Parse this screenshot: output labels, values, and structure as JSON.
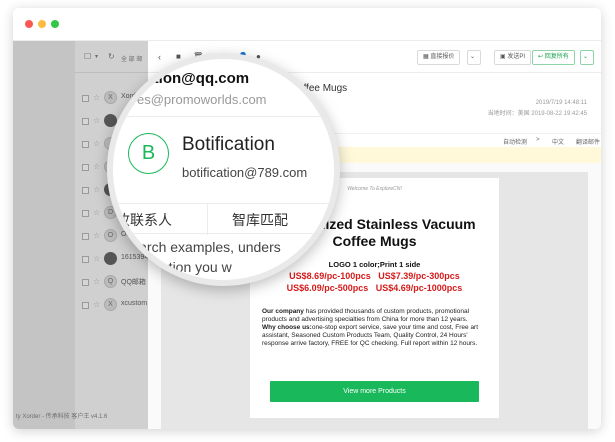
{
  "list_toolbar": {
    "icon_names": [
      "checkbox-icon",
      "refresh-icon"
    ],
    "text": "全 部 邮"
  },
  "mail_list": [
    {
      "avatar_text": "X",
      "from": "Xorder",
      "dark": false
    },
    {
      "avatar_text": "",
      "from": "",
      "dark": true
    },
    {
      "avatar_text": "",
      "from": "",
      "dark": false
    },
    {
      "avatar_text": "",
      "from": "",
      "dark": false
    },
    {
      "avatar_text": "",
      "from": "",
      "dark": true
    },
    {
      "avatar_text": "D",
      "from": "Delia",
      "dark": false
    },
    {
      "avatar_text": "O",
      "from": "OSChina",
      "dark": false
    },
    {
      "avatar_text": "",
      "from": "1615394",
      "dark": true
    },
    {
      "avatar_text": "Q",
      "from": "QQ邮箱",
      "dark": false
    },
    {
      "avatar_text": "X",
      "from": "xcustom",
      "dark": false
    }
  ],
  "status_bar": "ty Xorder - 传承科技 客户王 v4.1.6",
  "reader_toolbar": {
    "icons": [
      "back-icon",
      "square-icon",
      "delete-icon",
      "tag-icon",
      "person-icon",
      "clock-icon"
    ],
    "direct_quote_label": "直接报价",
    "send_pi_label": "发送PI",
    "reply_all_label": "回复所有"
  },
  "email": {
    "subject": "um Coffee Mugs",
    "date_line_1": "2019/7/19 14:48:11",
    "date_line_2": "当地时间：美国 2019-08-22 19:42:45",
    "translate_auto": "自动检测",
    "translate_arrow": ">",
    "translate_lang": "中文",
    "translate_action": "翻译邮件"
  },
  "card": {
    "welcome": "Welcome To ExploreCN!",
    "title_line_1": "Customized Stainless Vacuum",
    "title_line_2": "Coffee Mugs",
    "logo_line": "LOGO 1 color;Print 1 side",
    "prices": [
      [
        "US$8.69/pc-100pcs",
        "US$7.39/pc-300pcs"
      ],
      [
        "US$6.09/pc-500pcs",
        "US$4.69/pc-1000pcs"
      ]
    ],
    "para1_bold": "Our company",
    "para1_rest": " has provided thousands of custom products, promotional products and advertising specialties from China for more than 12 years.",
    "para2_bold": "Why choose us:",
    "para2_rest": "one-stop export service, save your time and cost, Free art assistant, Seasoned Custom Products Team, Quality Control, 24 Hours' response arrive factory, FREE for QC checking. Full report within 12 hours.",
    "cta_label": "View more Products"
  },
  "magnifier": {
    "email_line_1": "cation@qq.com",
    "email_line_2": "es@promoworlds.com",
    "avatar_letter": "B",
    "contact_name": "Botification",
    "contact_email": "botification@789.com",
    "action_1": "收联系人",
    "action_2": "智库匹配",
    "tip_line_1": "Search examples, unders",
    "tip_line_2": "information you w"
  },
  "colors": {
    "accent_green": "#19b85b",
    "price_red": "#d61a1a",
    "traffic_red": "#fc5753",
    "traffic_yellow": "#fdbc40",
    "traffic_green": "#33c748"
  }
}
